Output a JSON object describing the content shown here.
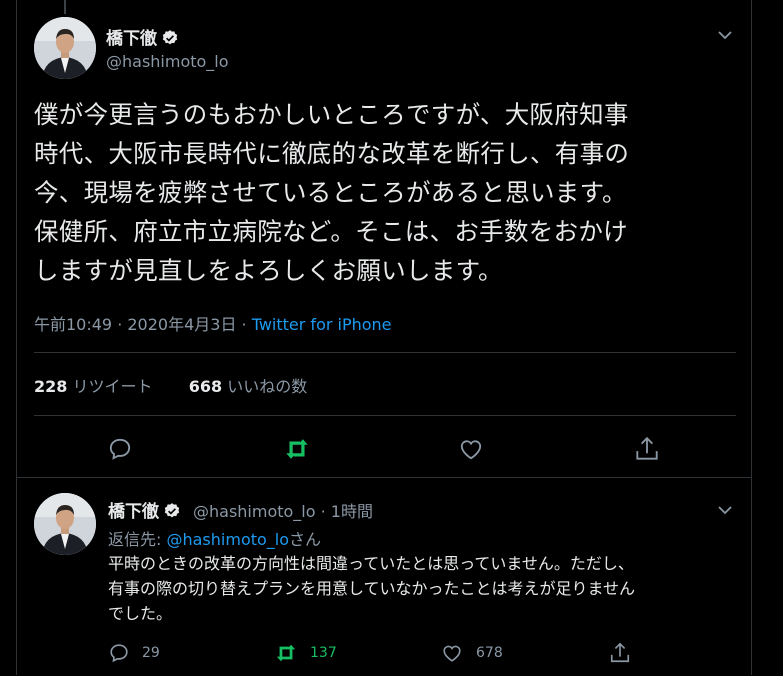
{
  "main_tweet": {
    "author_name": "橋下徹",
    "author_handle": "@hashimoto_lo",
    "lines": [
      "僕が今更言うのもおかしいところですが、大阪府知事",
      "時代、大阪市長時代に徹底的な改革を断行し、有事の",
      "今、現場を疲弊させているところがあると思います。",
      "保健所、府立市立病院など。そこは、お手数をおかけ",
      "しますが見直しをよろしくお願いします。"
    ],
    "timestamp": "午前10:49 · 2020年4月3日 · ",
    "source": "Twitter for iPhone",
    "retweet_count": "228",
    "retweet_label": "リツイート",
    "like_count": "668",
    "like_label": "いいねの数"
  },
  "reply_tweet": {
    "author_name": "橋下徹",
    "author_handle": "@hashimoto_lo · 1時間",
    "replying_prefix": "返信先: ",
    "replying_to": "@hashimoto_lo",
    "replying_suffix": "さん",
    "lines": [
      "平時のときの改革の方向性は間違っていたとは思っていません。ただし、",
      "有事の際の切り替えプランを用意していなかったことは考えが足りません",
      "でした。"
    ],
    "reply_count": "29",
    "retweet_count": "137",
    "like_count": "678"
  },
  "colors": {
    "background": "#000000",
    "text": "#e7e9ea",
    "secondary": "#8b98a5",
    "link": "#1d9bf0",
    "retweet_green": "#17bf63",
    "divider": "#2f3336"
  },
  "icons": [
    "verified-badge-icon",
    "chevron-down-icon",
    "reply-icon",
    "retweet-icon",
    "like-icon",
    "share-icon"
  ]
}
